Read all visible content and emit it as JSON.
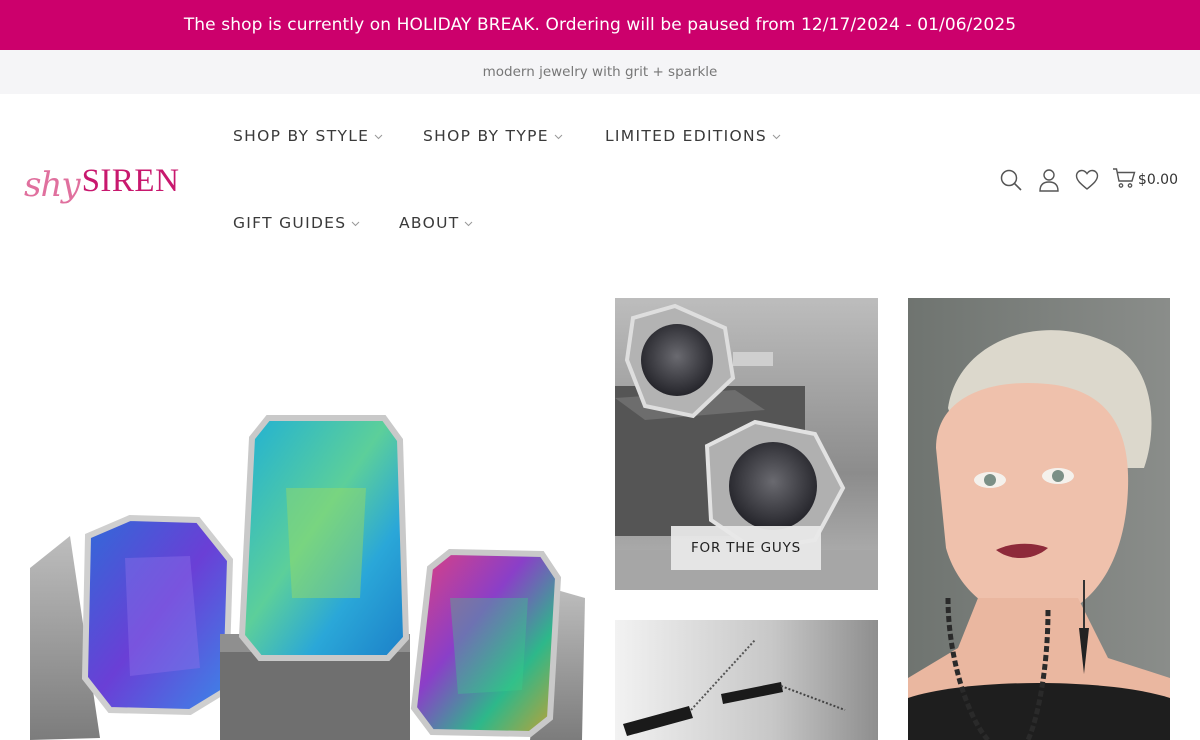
{
  "announcement": "The shop is currently on HOLIDAY BREAK. Ordering will be paused from 12/17/2024 - 01/06/2025",
  "tagline": "modern jewelry with grit + sparkle",
  "logo": {
    "prefix": "shy",
    "name": "SIREN"
  },
  "nav": {
    "items": [
      {
        "label": "SHOP BY STYLE"
      },
      {
        "label": "SHOP BY TYPE"
      },
      {
        "label": "LIMITED EDITIONS"
      },
      {
        "label": "GIFT GUIDES"
      },
      {
        "label": "ABOUT"
      }
    ]
  },
  "header_icons": [
    "search-icon",
    "account-icon",
    "wishlist-icon",
    "cart-icon"
  ],
  "cart": {
    "total": "$0.00"
  },
  "collections": {
    "for_the_guys": "FOR THE GUYS"
  },
  "colors": {
    "brand": "#cc006c",
    "logo_pink": "#e0709e",
    "tagline_bg": "#f5f5f7"
  }
}
